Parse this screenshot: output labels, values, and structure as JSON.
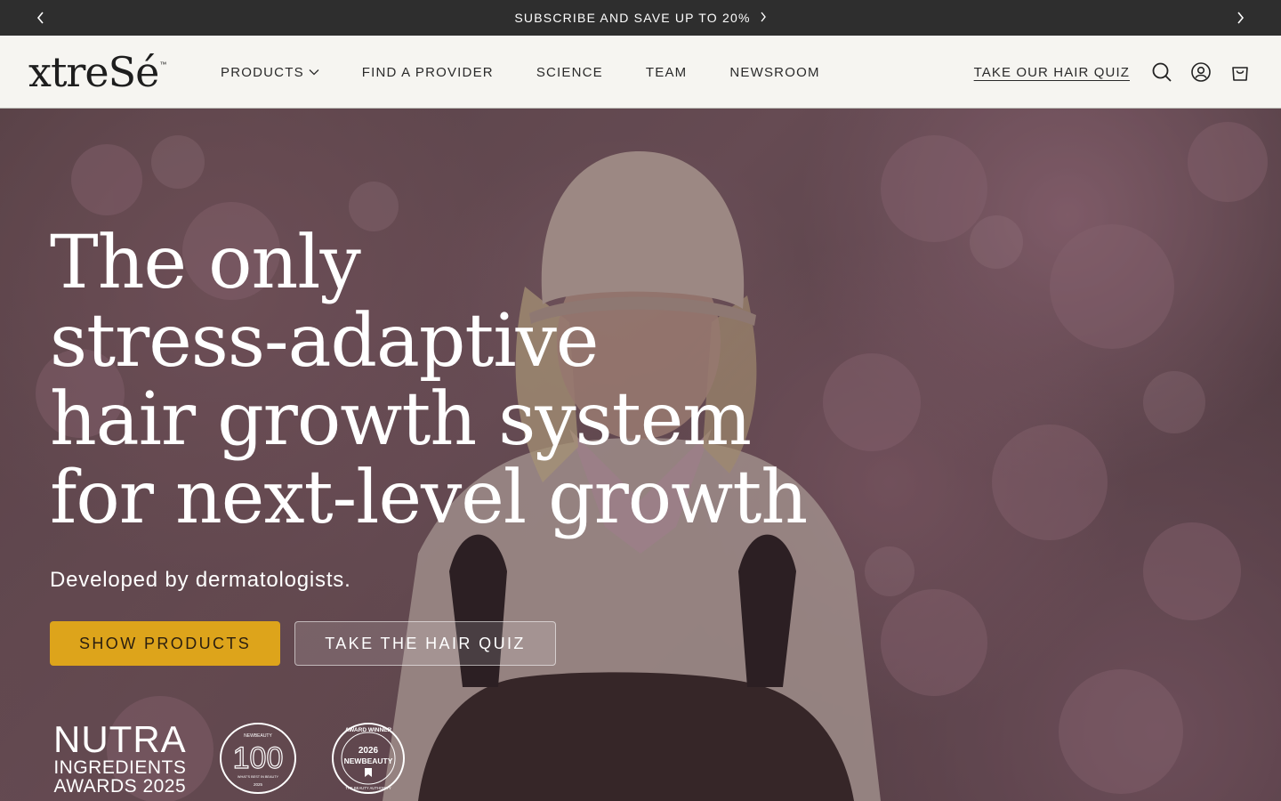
{
  "announcement": {
    "text": "SUBSCRIBE AND SAVE UP TO 20%"
  },
  "header": {
    "logo": "xtreSé",
    "logo_tm": "™",
    "nav": [
      {
        "label": "PRODUCTS",
        "has_dropdown": true
      },
      {
        "label": "FIND A PROVIDER"
      },
      {
        "label": "SCIENCE"
      },
      {
        "label": "TEAM"
      },
      {
        "label": "NEWSROOM"
      }
    ],
    "quiz_link": "TAKE OUR HAIR QUIZ",
    "icons": [
      "search-icon",
      "account-icon",
      "cart-icon"
    ]
  },
  "hero": {
    "title_lines": [
      "The only",
      "stress-adaptive",
      "hair growth system",
      "for next-level growth"
    ],
    "subtitle": "Developed by dermatologists.",
    "primary_button": "SHOW PRODUCTS",
    "secondary_button": "TAKE THE HAIR QUIZ",
    "awards": {
      "nutra": [
        "NUTRA",
        "INGREDIENTS",
        "AWARDS 2025"
      ],
      "newbeauty100": {
        "top": "NEWBEAUTY",
        "number": "100",
        "bottom": "WHAT'S BEST IN BEAUTY",
        "year": "2025"
      },
      "award_winner": {
        "ring": "AWARD WINNER",
        "year": "2026",
        "brand": "NEWBEAUTY",
        "ring_bottom": "THE BEAUTY AUTHORITY"
      }
    }
  },
  "colors": {
    "announce_bg": "#2e2e2e",
    "header_bg": "#f6f5f1",
    "primary_button": "#dda41b"
  }
}
